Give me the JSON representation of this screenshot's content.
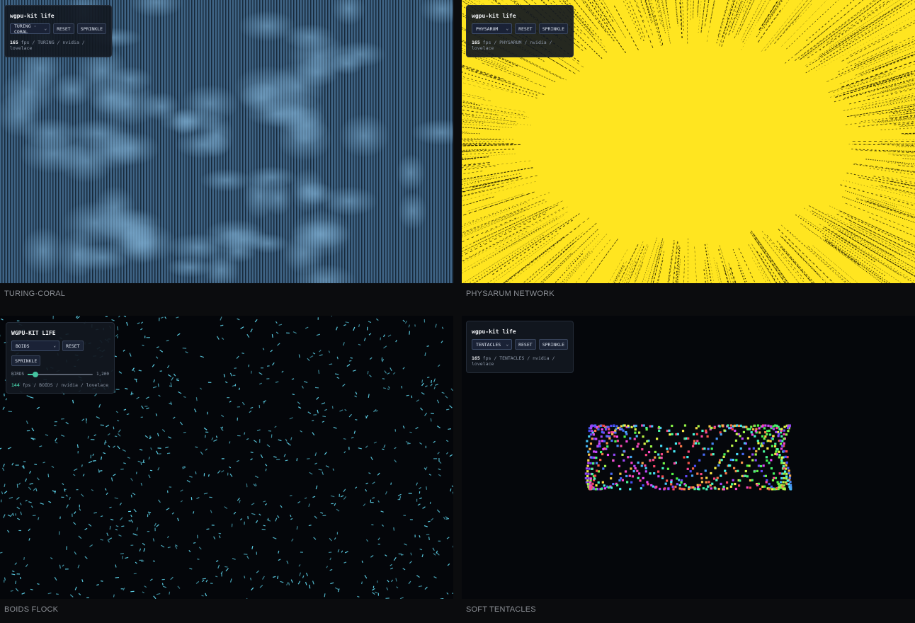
{
  "quadrants": {
    "turing": {
      "caption": "TURING·CORAL",
      "panel": {
        "title": "wgpu-kit life",
        "select_value": "TURING · CORAL",
        "buttons": [
          "RESET",
          "SPRINKLE"
        ],
        "fps": "165",
        "status_rest": "fps / TURING / nvidia / lovelace"
      },
      "bg_color": "#3d5f80"
    },
    "physarum": {
      "caption": "PHYSARUM NETWORK",
      "panel": {
        "title": "wgpu-kit life",
        "select_value": "PHYSARUM",
        "buttons": [
          "RESET",
          "SPRINKLE"
        ],
        "fps": "165",
        "status_rest": "fps / PHYSARUM / nvidia / lovelace"
      },
      "bg_color": "#ffe520"
    },
    "boids": {
      "caption": "BOIDS FLOCK",
      "panel": {
        "title": "WGPU-KIT LIFE",
        "select_value": "BOIDS",
        "buttons": [
          "RESET",
          "SPRINKLE"
        ],
        "slider_label": "BIRDS",
        "slider_value": "1,200",
        "slider_fraction": 0.12,
        "fps": "144",
        "status_rest": "fps / BOIDS / nvidia / lovelace"
      },
      "bird_color": "#5fd8f0"
    },
    "tentacles": {
      "caption": "SOFT TENTACLES",
      "panel": {
        "title": "wgpu-kit life",
        "select_value": "TENTACLES",
        "buttons": [
          "RESET",
          "SPRINKLE"
        ],
        "fps": "165",
        "status_rest": "fps / TENTACLES / nvidia / lovelace"
      }
    }
  },
  "icons": {
    "select_chevron": "chevron-down-icon"
  }
}
